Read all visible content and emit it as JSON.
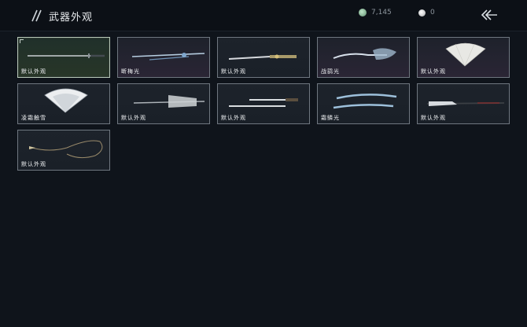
{
  "header": {
    "title": "武器外观",
    "jade_amount": "7,145",
    "pearl_amount": "0"
  },
  "items": [
    {
      "label": "默认外观",
      "icon": "long-sword"
    },
    {
      "label": "断梅光",
      "icon": "blue-rapier"
    },
    {
      "label": "默认外观",
      "icon": "gold-blade"
    },
    {
      "label": "战鹞光",
      "icon": "winged-blade"
    },
    {
      "label": "默认外观",
      "icon": "folding-fan"
    },
    {
      "label": "凌霜触雪",
      "icon": "white-fan"
    },
    {
      "label": "默认外观",
      "icon": "umbrella-spear"
    },
    {
      "label": "默认外观",
      "icon": "twin-blades"
    },
    {
      "label": "霜鳞光",
      "icon": "twin-curved-blades"
    },
    {
      "label": "默认外观",
      "icon": "long-glaive"
    },
    {
      "label": "默认外观",
      "icon": "rope-dart"
    }
  ]
}
